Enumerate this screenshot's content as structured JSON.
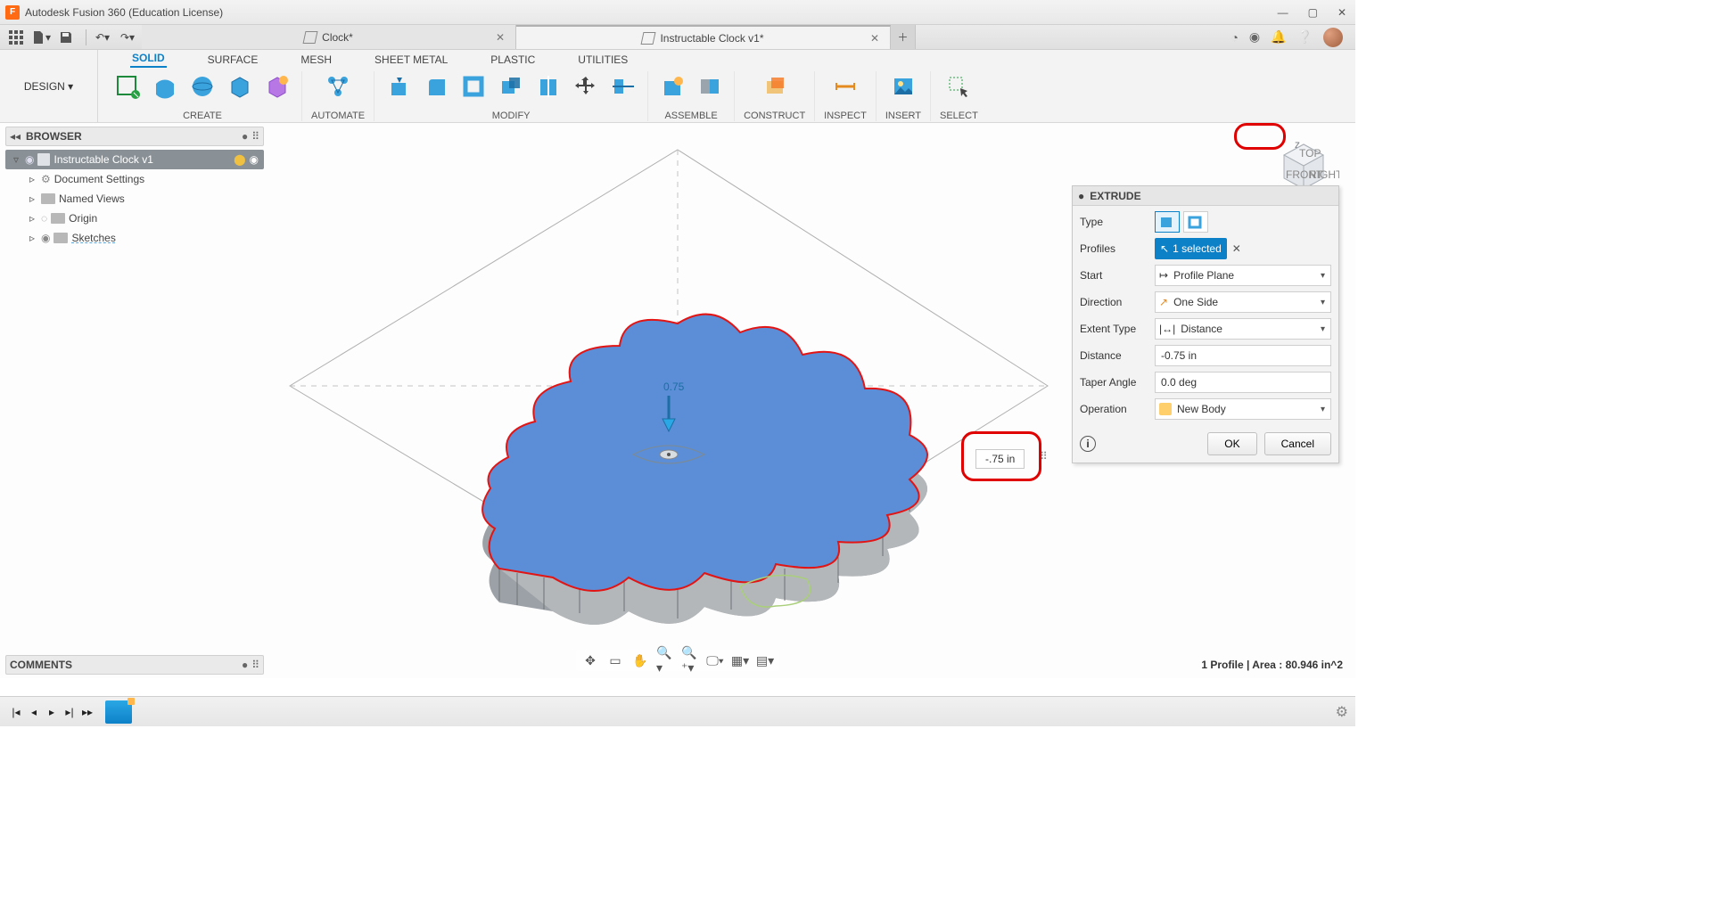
{
  "window": {
    "title": "Autodesk Fusion 360 (Education License)"
  },
  "documents": [
    {
      "label": "Clock*",
      "active": false
    },
    {
      "label": "Instructable Clock v1*",
      "active": true
    }
  ],
  "workspace_dropdown": "DESIGN",
  "ribbon_tabs": [
    "SOLID",
    "SURFACE",
    "MESH",
    "SHEET METAL",
    "PLASTIC",
    "UTILITIES"
  ],
  "ribbon_active_tab": "SOLID",
  "ribbon_groups": [
    "CREATE",
    "AUTOMATE",
    "MODIFY",
    "ASSEMBLE",
    "CONSTRUCT",
    "INSPECT",
    "INSERT",
    "SELECT"
  ],
  "browser": {
    "title": "BROWSER",
    "root": "Instructable Clock v1",
    "nodes": [
      "Document Settings",
      "Named Views",
      "Origin",
      "Sketches"
    ]
  },
  "extrude": {
    "title": "EXTRUDE",
    "rows": {
      "type_label": "Type",
      "profiles_label": "Profiles",
      "profiles_value": "1 selected",
      "start_label": "Start",
      "start_value": "Profile Plane",
      "direction_label": "Direction",
      "direction_value": "One Side",
      "extent_label": "Extent Type",
      "extent_value": "Distance",
      "distance_label": "Distance",
      "distance_value": "-0.75 in",
      "taper_label": "Taper Angle",
      "taper_value": "0.0 deg",
      "operation_label": "Operation",
      "operation_value": "New Body"
    },
    "ok": "OK",
    "cancel": "Cancel"
  },
  "canvas_overlay": {
    "drag_label": "0.75",
    "float_value": "-.75 in"
  },
  "comments_title": "COMMENTS",
  "status_text": "1 Profile | Area : 80.946 in^2",
  "viewcube_axis": "z"
}
